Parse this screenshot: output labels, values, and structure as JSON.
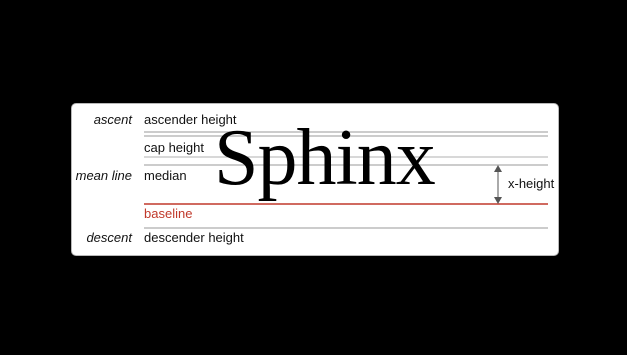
{
  "diagram": {
    "sample_word": "Sphinx",
    "left_labels": {
      "ascent": "ascent",
      "mean_line": "mean line",
      "descent": "descent"
    },
    "line_labels": {
      "ascender": "ascender height",
      "cap": "cap height",
      "median": "median",
      "baseline": "baseline",
      "descender": "descender height"
    },
    "x_height_label": "x-height",
    "colors": {
      "baseline": "#c0392b",
      "guide_lines": "#9a9a9a",
      "background": "#000000",
      "card": "#ffffff"
    }
  }
}
